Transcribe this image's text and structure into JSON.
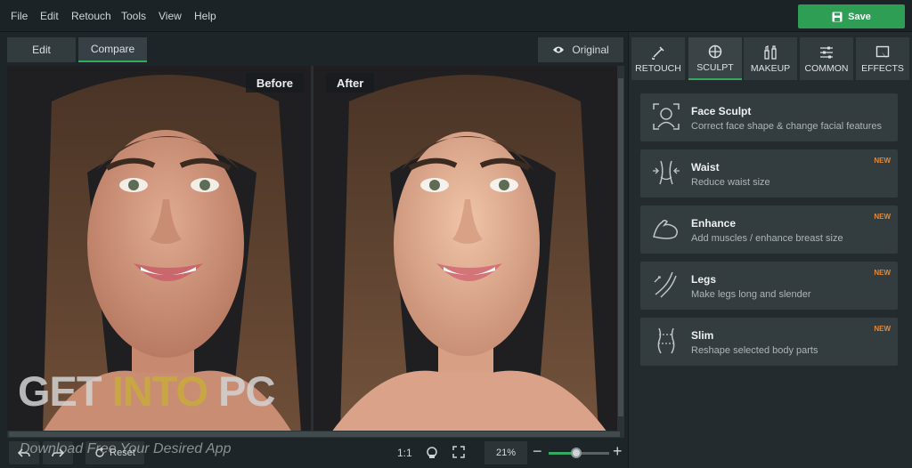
{
  "menu": {
    "items": [
      "File",
      "Edit",
      "Retouch",
      "Tools",
      "View",
      "Help"
    ],
    "save_label": "Save"
  },
  "view": {
    "edit_label": "Edit",
    "compare_label": "Compare",
    "original_label": "Original"
  },
  "canvas": {
    "before_label": "Before",
    "after_label": "After"
  },
  "watermark": {
    "text_get": "GET ",
    "text_into": "INTO",
    "text_pc": " PC",
    "subtitle": "Download Free Your Desired App"
  },
  "bottombar": {
    "reset_label": "Reset",
    "one_to_one": "1:1",
    "zoom": "21%",
    "zoom_fraction": 0.45
  },
  "tabs": [
    {
      "label": "RETOUCH",
      "icon": "brush-icon"
    },
    {
      "label": "SCULPT",
      "icon": "sculpt-icon"
    },
    {
      "label": "MAKEUP",
      "icon": "makeup-icon"
    },
    {
      "label": "COMMON",
      "icon": "sliders-icon"
    },
    {
      "label": "EFFECTS",
      "icon": "effects-icon"
    }
  ],
  "active_tab": "SCULPT",
  "tools": [
    {
      "title": "Face Sculpt",
      "desc": "Correct face shape & change facial features",
      "badge": ""
    },
    {
      "title": "Waist",
      "desc": "Reduce waist size",
      "badge": "NEW"
    },
    {
      "title": "Enhance",
      "desc": "Add muscles / enhance breast size",
      "badge": "NEW"
    },
    {
      "title": "Legs",
      "desc": "Make legs long and slender",
      "badge": "NEW"
    },
    {
      "title": "Slim",
      "desc": "Reshape selected body parts",
      "badge": "NEW"
    }
  ],
  "colors": {
    "accent": "#36a860",
    "save_bg": "#2e9e55",
    "badge": "#e08a3a",
    "panel_bg": "#232b2e"
  }
}
